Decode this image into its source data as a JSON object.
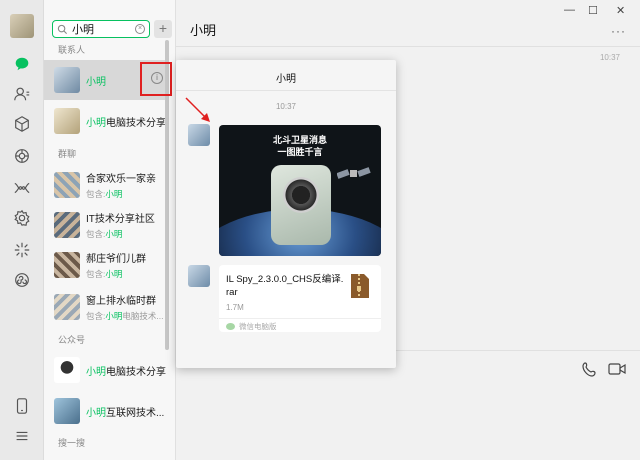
{
  "window": {
    "title": "小明",
    "more": "···",
    "minimize": "—",
    "maximize": "☐",
    "close": "✕"
  },
  "search": {
    "value": "小明",
    "clear_glyph": "×",
    "add_glyph": "+"
  },
  "sections": {
    "contacts": "联系人",
    "groups": "群聊",
    "official": "公众号",
    "search_more": "搜一搜"
  },
  "contacts": [
    {
      "name_hl": "小明",
      "name_rest": "",
      "selected": true
    },
    {
      "name_hl": "小明",
      "name_rest": "电脑技术分享",
      "selected": false
    }
  ],
  "groups": [
    {
      "name": "合家欢乐一家亲",
      "sub_pre": "包含:",
      "sub_hl": "小明",
      "sub_post": ""
    },
    {
      "name": "IT技术分享社区",
      "sub_pre": "包含:",
      "sub_hl": "小明",
      "sub_post": ""
    },
    {
      "name": "郝庄爷们儿群",
      "sub_pre": "包含:",
      "sub_hl": "小明",
      "sub_post": ""
    },
    {
      "name": "窗上排水临时群",
      "sub_pre": "包含:",
      "sub_hl": "小明",
      "sub_post": "电脑技术..."
    }
  ],
  "officials": [
    {
      "name_hl": "小明",
      "name_rest": "电脑技术分享"
    },
    {
      "name_hl": "小明",
      "name_rest": "互联网技术..."
    }
  ],
  "info_glyph": "i",
  "main_timestamp": "10:37",
  "popup": {
    "title": "小明",
    "time": "10:37",
    "image_headline_1": "北斗卫星消息",
    "image_headline_2": "一图胜千言",
    "file": {
      "name": "IL Spy_2.3.0.0_CHS反编译.rar",
      "size": "1.7M",
      "source": "微信电脑版"
    }
  },
  "colors": {
    "accent": "#07c160",
    "annotation_red": "#e02020"
  },
  "icons": [
    "chat-icon",
    "contacts-icon",
    "favorites-icon",
    "moments-icon",
    "channels-icon",
    "settings-icon",
    "search-icon",
    "miniprogram-icon",
    "phone-icon",
    "menu-icon",
    "info-icon",
    "voice-call-icon",
    "video-call-icon"
  ]
}
